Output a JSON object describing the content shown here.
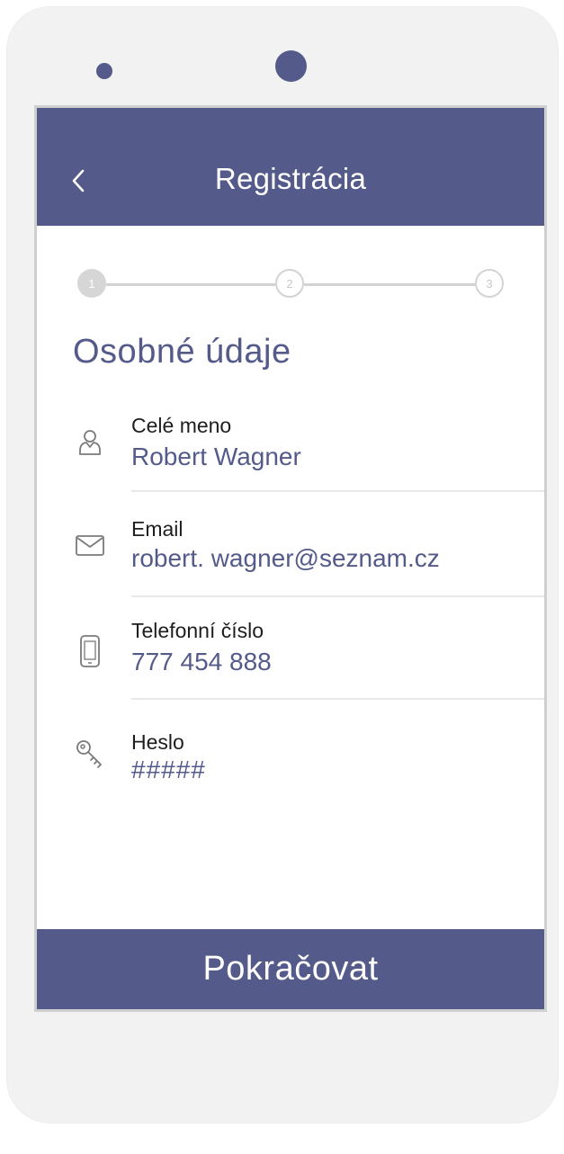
{
  "header": {
    "title": "Registrácia",
    "back_icon": "chevron-left-icon"
  },
  "stepper": {
    "steps": [
      "1",
      "2",
      "3"
    ],
    "current": 1
  },
  "section_title": "Osobné údaje",
  "fields": [
    {
      "icon": "user-icon",
      "label": "Celé meno",
      "value": "Robert Wagner"
    },
    {
      "icon": "envelope-icon",
      "label": "Email",
      "value": "robert. wagner@seznam.cz"
    },
    {
      "icon": "phone-icon",
      "label": "Telefonní číslo",
      "value": "777 454 888"
    },
    {
      "icon": "key-icon",
      "label": "Heslo",
      "value": "#####"
    }
  ],
  "continue_label": "Pokračovat",
  "colors": {
    "accent": "#545a8a",
    "phone_body": "#f2f2f2",
    "divider": "#e8e8e8",
    "step_inactive": "#d3d3d3"
  }
}
